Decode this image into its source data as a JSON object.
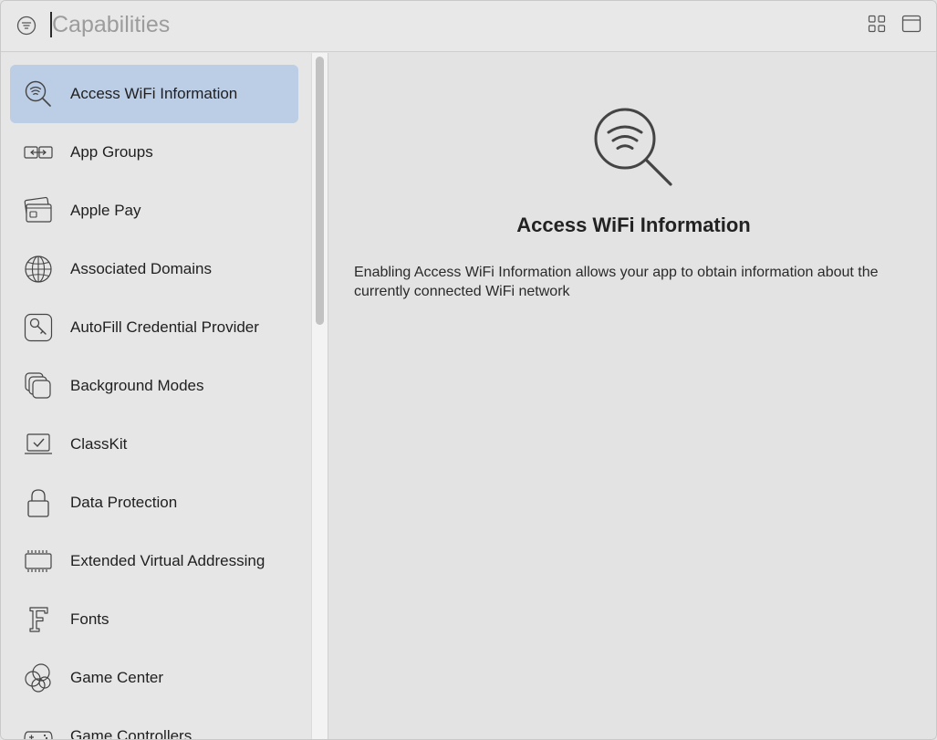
{
  "search": {
    "placeholder": "Capabilities",
    "value": ""
  },
  "toolbar": {
    "filter_icon": "filter-circle-icon",
    "grid_icon": "grid-view-icon",
    "panel_icon": "panel-toggle-icon"
  },
  "sidebar": {
    "selected_index": 0,
    "selected_color": "#bccde6",
    "items": [
      {
        "label": "Access WiFi Information",
        "icon": "wifi-search-icon"
      },
      {
        "label": "App Groups",
        "icon": "app-groups-icon"
      },
      {
        "label": "Apple Pay",
        "icon": "credit-card-icon"
      },
      {
        "label": "Associated Domains",
        "icon": "globe-icon"
      },
      {
        "label": "AutoFill Credential Provider",
        "icon": "key-icon"
      },
      {
        "label": "Background Modes",
        "icon": "stacked-layers-icon"
      },
      {
        "label": "ClassKit",
        "icon": "checkmark-screen-icon"
      },
      {
        "label": "Data Protection",
        "icon": "lock-icon"
      },
      {
        "label": "Extended Virtual Addressing",
        "icon": "memory-chip-icon"
      },
      {
        "label": "Fonts",
        "icon": "font-f-icon"
      },
      {
        "label": "Game Center",
        "icon": "game-center-icon"
      },
      {
        "label": "Game Controllers",
        "icon": "game-controller-icon"
      }
    ]
  },
  "detail": {
    "icon": "wifi-search-icon",
    "title": "Access WiFi Information",
    "description": "Enabling Access WiFi Information allows your app to obtain information about the currently connected WiFi network"
  }
}
